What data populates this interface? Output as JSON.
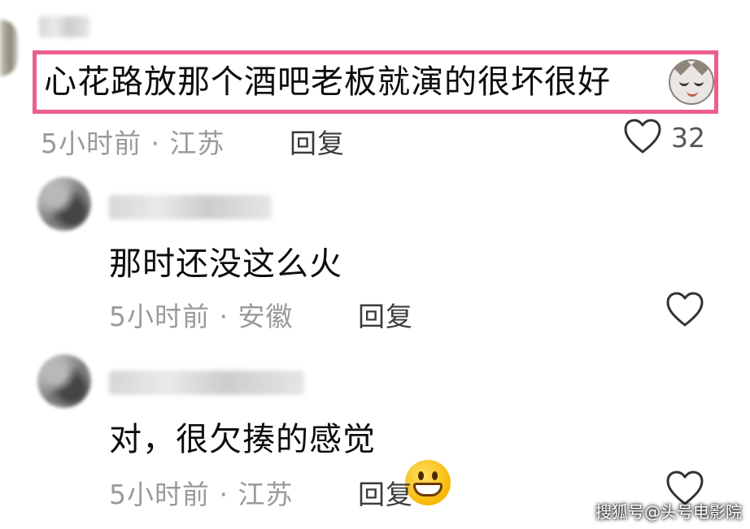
{
  "comments": [
    {
      "text": "心花路放那个酒吧老板就演的很坏很好",
      "emoji": "cat-emoji",
      "time_location": "5小时前 · 江苏",
      "reply_label": "回复",
      "like_count": "32",
      "highlighted": true,
      "highlight_color": "#ec5e8f"
    },
    {
      "text": "那时还没这么火",
      "time_location": "5小时前 · 安徽",
      "reply_label": "回复"
    },
    {
      "text": "对，很欠揍的感觉",
      "emoji": "grinning-face-emoji",
      "time_location": "5小时前 · 江苏",
      "reply_label": "回复"
    }
  ],
  "watermark": "搜狐号@头号电影院"
}
